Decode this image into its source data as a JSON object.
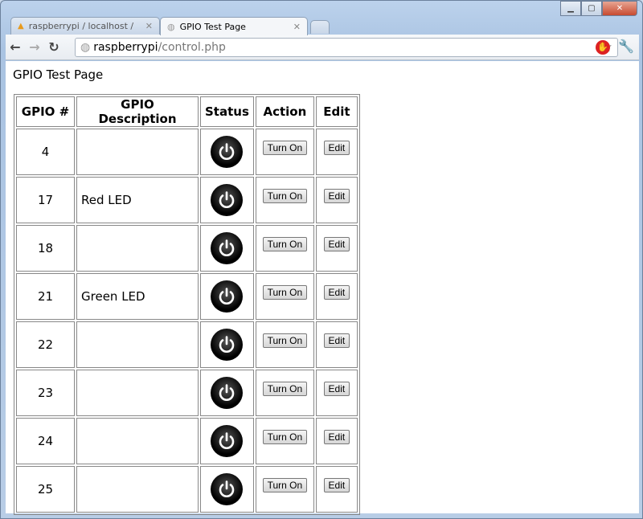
{
  "browser": {
    "tabs": [
      {
        "label": "raspberrypi / localhost / gpio",
        "icon": "phpmyadmin-icon"
      },
      {
        "label": "GPIO Test Page",
        "icon": "globe-icon",
        "active": true
      }
    ],
    "url_host": "raspberrypi",
    "url_path": "/control.php"
  },
  "page": {
    "title": "GPIO Test Page",
    "headers": [
      "GPIO #",
      "GPIO Description",
      "Status",
      "Action",
      "Edit"
    ],
    "rows": [
      {
        "gpio": "4",
        "description": "",
        "status": "off",
        "action": "Turn On",
        "edit": "Edit"
      },
      {
        "gpio": "17",
        "description": "Red LED",
        "status": "off",
        "action": "Turn On",
        "edit": "Edit"
      },
      {
        "gpio": "18",
        "description": "",
        "status": "off",
        "action": "Turn On",
        "edit": "Edit"
      },
      {
        "gpio": "21",
        "description": "Green LED",
        "status": "off",
        "action": "Turn On",
        "edit": "Edit"
      },
      {
        "gpio": "22",
        "description": "",
        "status": "off",
        "action": "Turn On",
        "edit": "Edit"
      },
      {
        "gpio": "23",
        "description": "",
        "status": "off",
        "action": "Turn On",
        "edit": "Edit"
      },
      {
        "gpio": "24",
        "description": "",
        "status": "off",
        "action": "Turn On",
        "edit": "Edit"
      },
      {
        "gpio": "25",
        "description": "",
        "status": "off",
        "action": "Turn On",
        "edit": "Edit"
      }
    ]
  }
}
